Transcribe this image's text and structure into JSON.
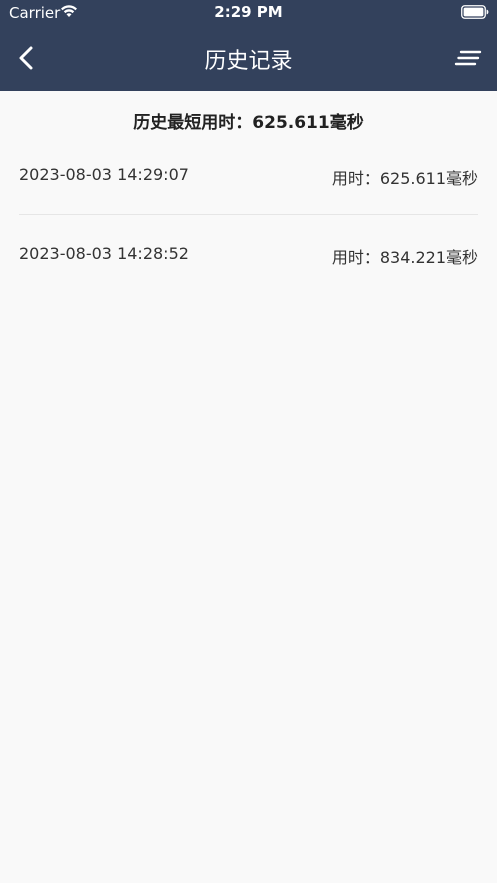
{
  "status_bar": {
    "carrier": "Carrier",
    "time": "2:29 PM"
  },
  "nav": {
    "title": "历史记录",
    "back_icon": "chevron-left-icon",
    "menu_icon": "menu-lines-icon"
  },
  "best_record": "历史最短用时：625.611毫秒",
  "records": [
    {
      "datetime": "2023-08-03 14:29:07",
      "duration": "用时：625.611毫秒"
    },
    {
      "datetime": "2023-08-03 14:28:52",
      "duration": "用时：834.221毫秒"
    }
  ],
  "colors": {
    "header_bg": "#33415c",
    "page_bg": "#f9f9f9",
    "text": "#333333",
    "divider": "#e6e6e6"
  }
}
